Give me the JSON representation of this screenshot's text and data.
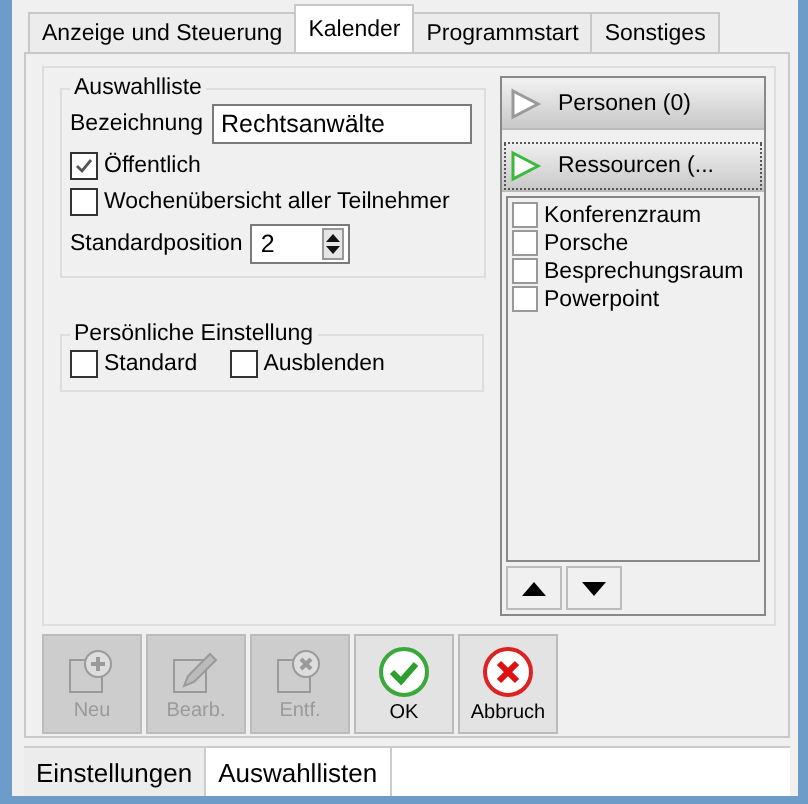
{
  "tabs": [
    {
      "label": "Anzeige und Steuerung",
      "selected": false
    },
    {
      "label": "Kalender",
      "selected": true
    },
    {
      "label": "Programmstart",
      "selected": false
    },
    {
      "label": "Sonstiges",
      "selected": false
    }
  ],
  "selection_list": {
    "title": "Auswahlliste",
    "name_label": "Bezeichnung",
    "name_value": "Rechtsanwälte",
    "options": [
      {
        "label": "Öffentlich",
        "checked": true
      },
      {
        "label": "Wochenübersicht aller Teilnehmer",
        "checked": false
      }
    ],
    "position_label": "Standardposition",
    "position_value": "2"
  },
  "personal_settings": {
    "title": "Persönliche Einstellung",
    "options": [
      {
        "label": "Standard",
        "checked": false
      },
      {
        "label": "Ausblenden",
        "checked": false
      }
    ]
  },
  "side_panel": {
    "sections": [
      {
        "label": "Personen (0)",
        "expanded": false
      },
      {
        "label": "Ressourcen (...",
        "expanded": true
      }
    ],
    "items": [
      {
        "label": "Konferenzraum",
        "checked": false
      },
      {
        "label": "Porsche",
        "checked": false
      },
      {
        "label": "Besprechungsraum",
        "checked": false
      },
      {
        "label": "Powerpoint",
        "checked": false
      }
    ]
  },
  "toolbar": [
    {
      "kind": "add",
      "label": "Neu",
      "disabled": true
    },
    {
      "kind": "edit",
      "label": "Bearb.",
      "disabled": true
    },
    {
      "kind": "delete",
      "label": "Entf.",
      "disabled": true
    },
    {
      "kind": "ok",
      "label": "OK",
      "disabled": false
    },
    {
      "kind": "cancel",
      "label": "Abbruch",
      "disabled": false
    }
  ],
  "bottom_tabs": [
    {
      "label": "Einstellungen",
      "selected": false
    },
    {
      "label": "Auswahllisten",
      "selected": true
    }
  ]
}
